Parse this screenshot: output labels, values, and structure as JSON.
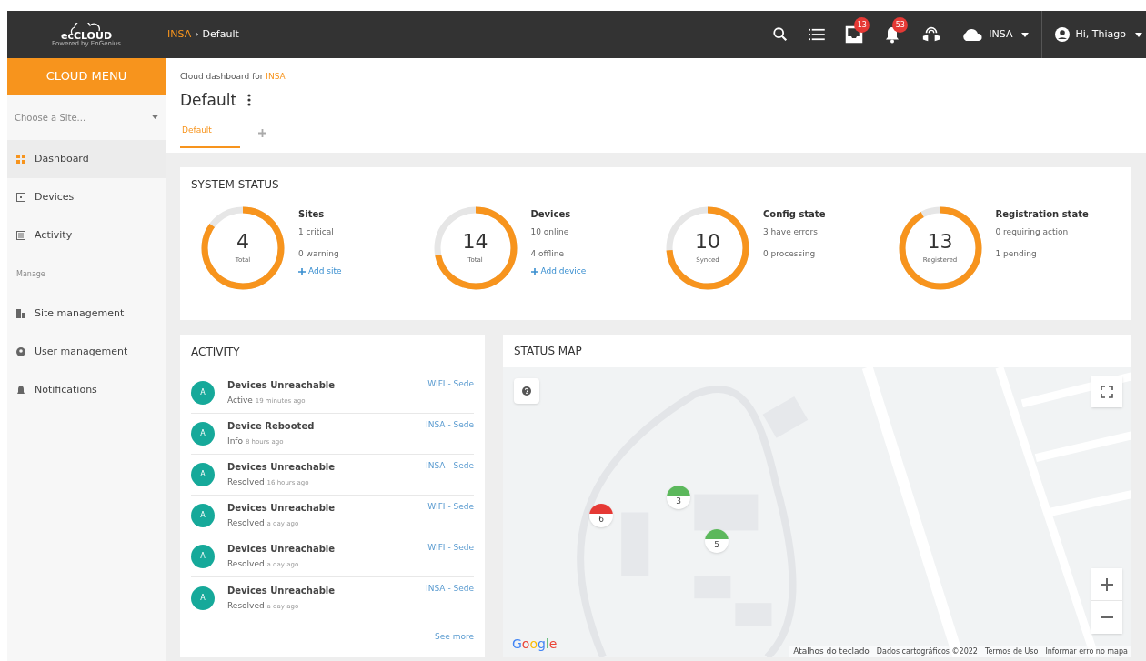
{
  "header": {
    "logo": "ecCLOUD",
    "logo_sub": "Powered by EnGenius",
    "breadcrumb": [
      {
        "label": "INSA",
        "link": true
      },
      {
        "label": "›",
        "link": false
      },
      {
        "label": "Default",
        "link": false
      }
    ],
    "icons": [
      {
        "kind": "search"
      },
      {
        "kind": "list"
      },
      {
        "kind": "inbox",
        "badge": "13"
      },
      {
        "kind": "bell",
        "badge": "53"
      },
      {
        "kind": "headset"
      }
    ],
    "org": "INSA",
    "user": "Hi, Thiago"
  },
  "sidebar": {
    "title": "CLOUD MENU",
    "site_select": {
      "placeholder": "Choose a Site..."
    },
    "items": [
      {
        "label": "Dashboard",
        "selected": true
      },
      {
        "label": "Devices",
        "selected": false
      },
      {
        "label": "Activity",
        "selected": false
      }
    ],
    "section": "Manage",
    "manage_items": [
      {
        "label": "Site management",
        "selected": false
      },
      {
        "label": "User management",
        "selected": false
      },
      {
        "label": "Notifications",
        "selected": false
      }
    ]
  },
  "page": {
    "subtitle_prefix": "Cloud dashboard for",
    "subtitle_site": "INSA",
    "title": "Default",
    "tabs": [
      {
        "label": "Default",
        "selected": true
      }
    ]
  },
  "system_status": {
    "title": "SYSTEM STATUS",
    "stats": [
      {
        "value": "4",
        "caption": "Total",
        "level": 0.85,
        "name": "Sites",
        "lines": [
          "1 critical",
          "0 warning"
        ],
        "link": "Add site"
      },
      {
        "value": "14",
        "caption": "Total",
        "level": 0.72,
        "name": "Devices",
        "lines": [
          "10 online",
          "4 offline"
        ],
        "link": "Add device"
      },
      {
        "value": "10",
        "caption": "Synced",
        "level": 0.74,
        "name": "Config state",
        "lines": [
          "3 have errors",
          "0 processing"
        ]
      },
      {
        "value": "13",
        "caption": "Registered",
        "level": 0.92,
        "name": "Registration state",
        "lines": [
          "0 requiring action",
          "1 pending"
        ]
      }
    ]
  },
  "activity": {
    "title": "ACTIVITY",
    "rows": [
      {
        "avatar": "A",
        "title": "Devices Unreachable",
        "status": "Active",
        "time": "19 minutes ago",
        "site": "WIFI - Sede"
      },
      {
        "avatar": "A",
        "title": "Device Rebooted",
        "status": "Info",
        "time": "8 hours ago",
        "site": "INSA - Sede"
      },
      {
        "avatar": "A",
        "title": "Devices Unreachable",
        "status": "Resolved",
        "time": "16 hours ago",
        "site": "INSA - Sede"
      },
      {
        "avatar": "A",
        "title": "Devices Unreachable",
        "status": "Resolved",
        "time": "a day ago",
        "site": "WIFI - Sede"
      },
      {
        "avatar": "A",
        "title": "Devices Unreachable",
        "status": "Resolved",
        "time": "a day ago",
        "site": "WIFI - Sede"
      },
      {
        "avatar": "A",
        "title": "Devices Unreachable",
        "status": "Resolved",
        "time": "a day ago",
        "site": "INSA - Sede"
      }
    ],
    "more": "See more"
  },
  "status_map": {
    "title": "STATUS MAP",
    "markers": [
      {
        "count": "6",
        "color": "#e53935"
      },
      {
        "count": "3",
        "color": "#5cb85c"
      },
      {
        "count": "5",
        "color": "#5cb85c"
      }
    ],
    "google": "Google",
    "attribution": [
      "Atalhos do teclado",
      "Dados cartográficos ©2022",
      "Termos de Uso",
      "Informar erro no mapa"
    ]
  }
}
